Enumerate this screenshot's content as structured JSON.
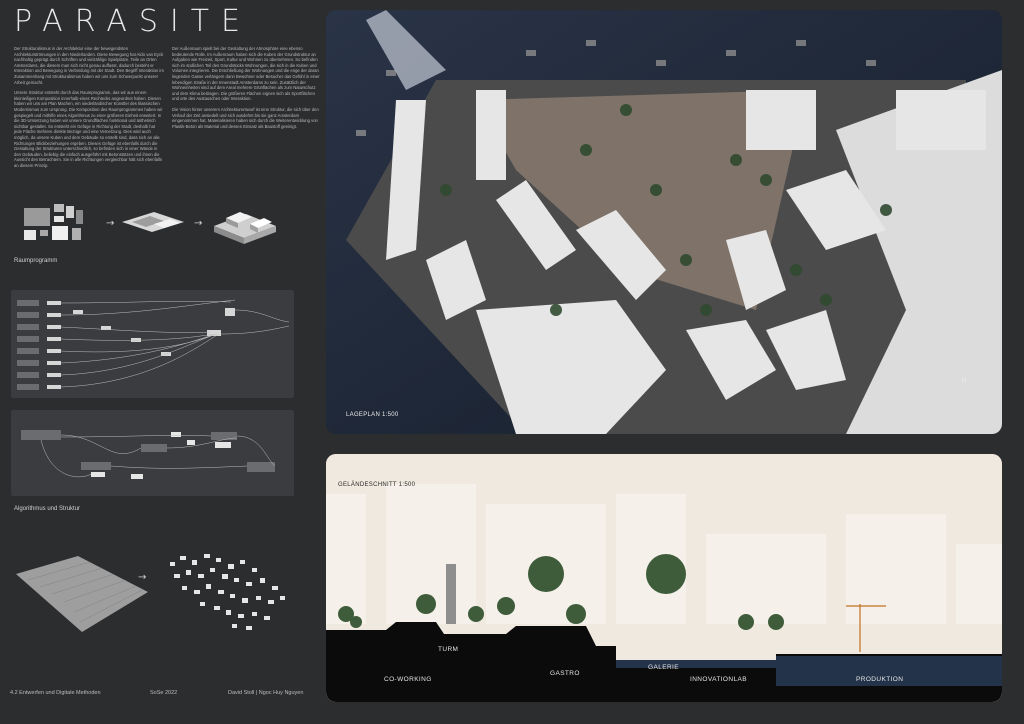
{
  "header": {
    "title": "PARASITE"
  },
  "intro": {
    "column_a": [
      "Der Strukturalismus in der Architektur eine der bewegendsten Architekturströmungen in den Niederlanden. Diese Bewegung hat Aldo van Eyck nachhaltig geprägt durch Schriften und vielzählige Spielplätze. Teile an Orten Amsterdams, die diesem man sich nicht genau auffasst, dadurch besteht er Interaktion und Bewegung in Verbindung mit der Stadt. Den Begriff Interaktion im Zusammenhang mit Strukturalismus haben wir uns zum Schwerpunkt unserer Arbeit gemacht.",
      "Unsere Struktur entsteht durch das Raumprogramm, das wir aus einem kleinteiligen Komposition innerhalb eines Rechtecks angeordnet haben. Diesen haben wir uns am Plan Machen, ein niederländischer Künstler des klassischen Modernismus zum Ursprung. Die Komposition des Raumprogrammes haben wir gespiegelt und mithilfe eines Algorithmus zu einer größeren Einheit erweitert. In die 3D-Umsetzung haben wir unsere Grundflächen funktional und ästhetisch sichtbar gestaltet. So entsteht ein Gefüge in Richtung der Stadt, deshalb hat jede Fläche mehrere direkte Bezüge und eine Vernetzung. Dies wird auch möglich, da unsere Kuben und dem Gebäude so erstellt sind, dass sich an alle Richtungen Blickbeziehungen ergeben. Dieses Gefüge ist ebenfalls durch die Gestaltung der Strukturen unterschiedlich, so befinden sich in einer Wände in den Gebäuden, beliebig die einfach ausgeführt mit Betonstützen und ihnen die Aussicht den Betrachtern. Sie in alle Richtungen vergleichbar hält sich ebenfalls an diesem Prinzip."
    ],
    "column_b": [
      "Der Außenraum spielt bei der Gestaltung der Atmosphäre eine ebenso bedeutende Rolle. Im Außenraum haben sich die Kuben der Grundstruktur an Aufgaben wie Freizeit, Sport, Kultur und Wohnen zu übernehmen. So befinden sich im südlichen Teil des Grundstücks Wohnungen, die sich in die Kuben und Volumen integrieren. Die Erschließung der Wohnungen und die enge der daran liegenden Gasse verlängern dann Bewohner oder Besucher das Gefühl in einer lebendigen Straße in der Innenstadt Amsterdams zu sein. Zusätzlich der Wohneinheiten sind auf dem Areal mehrere Grünflächen als zum Naturschutz und dem Klima beitragen. Die größeren Flächen eignen sich als Sportflächen und orte des Austausches oder Interaktion.",
      "Die Vision hinter unserem Architekturentwurf ist eine Struktur, die sich über den Verlauf der Zeit ansiedelt und sich ausdehnt bis sie ganz Amsterdam eingenommen hat. Materialisieren haben sich durch die Weiterentwicklung von Plastik-Beton als Material und dessen Einsatz als Baustoff geeinigt."
    ]
  },
  "labels": {
    "raumprogramm": "Raumprogramm",
    "algorithmus": "Algorithmus und Struktur",
    "lageplan": "LAGEPLAN  1:500",
    "gelaendeschnitt": "GELÄNDESCHNITT  1:500",
    "north": "N"
  },
  "section_zones": {
    "turm": "TURM",
    "coworking": "CO-WORKING",
    "gastro": "GASTRO",
    "galerie": "GALERIE",
    "innovationlab": "INNOVATIONLAB",
    "produktion": "PRODUKTION"
  },
  "footer": {
    "course": "4.2 Entwerfen und Digitale Methoden",
    "semester": "SoSe 2022",
    "authors": "David Stoll  |  Ngoc Huy Nguyen"
  },
  "colors": {
    "background": "#2c2d2f",
    "water": "#1d2634",
    "buildings": "#e9e9ea",
    "ground": "#8f857c",
    "accent_water": "#23344a"
  }
}
